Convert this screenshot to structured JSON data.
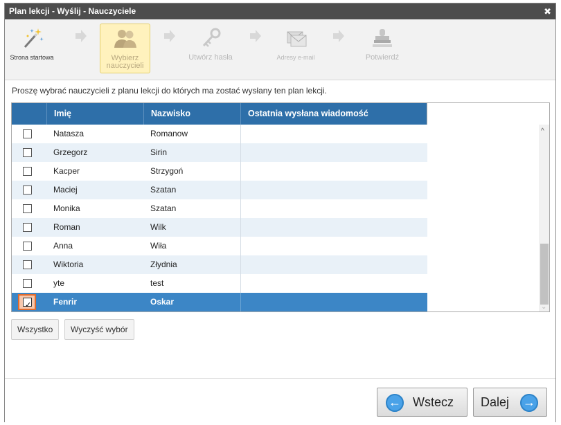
{
  "window": {
    "title": "Plan lekcji - Wyślij - Nauczyciele",
    "close_symbol": "✖"
  },
  "wizard": {
    "steps": [
      {
        "label": "Strona startowa",
        "icon": "magic-wand-icon",
        "state": "done"
      },
      {
        "label": "Wybierz nauczycieli",
        "icon": "users-icon",
        "state": "active"
      },
      {
        "label": "Utwórz hasła",
        "icon": "key-icon",
        "state": "disabled"
      },
      {
        "label": "Adresy e-mail",
        "icon": "envelope-icon",
        "state": "disabled"
      },
      {
        "label": "Potwierdź",
        "icon": "stamp-icon",
        "state": "disabled"
      }
    ]
  },
  "intro_text": "Proszę wybrać nauczycieli z planu lekcji do których ma zostać wysłany ten plan lekcji.",
  "table": {
    "columns": [
      "Imię",
      "Nazwisko",
      "Ostatnia wysłana wiadomość"
    ],
    "rows": [
      {
        "first": "Natasza",
        "last": "Romanow",
        "last_message": "",
        "checked": false
      },
      {
        "first": "Grzegorz",
        "last": "Sirin",
        "last_message": "",
        "checked": false
      },
      {
        "first": "Kacper",
        "last": "Strzygoń",
        "last_message": "",
        "checked": false
      },
      {
        "first": "Maciej",
        "last": "Szatan",
        "last_message": "",
        "checked": false
      },
      {
        "first": "Monika",
        "last": "Szatan",
        "last_message": "",
        "checked": false
      },
      {
        "first": "Roman",
        "last": "Wilk",
        "last_message": "",
        "checked": false
      },
      {
        "first": "Anna",
        "last": "Wiła",
        "last_message": "",
        "checked": false
      },
      {
        "first": "Wiktoria",
        "last": "Złydnia",
        "last_message": "",
        "checked": false
      },
      {
        "first": "yte",
        "last": "test",
        "last_message": "",
        "checked": false
      },
      {
        "first": "Fenrir",
        "last": "Oskar",
        "last_message": "",
        "checked": true
      }
    ]
  },
  "buttons": {
    "select_all": "Wszystko",
    "clear_selection": "Wyczyść wybór",
    "back": "Wstecz",
    "next": "Dalej"
  },
  "colors": {
    "header_blue": "#2e6fa9",
    "selected_row": "#3c86c6",
    "highlight_orange": "#e36b2c",
    "active_step": "#fff2bd"
  }
}
